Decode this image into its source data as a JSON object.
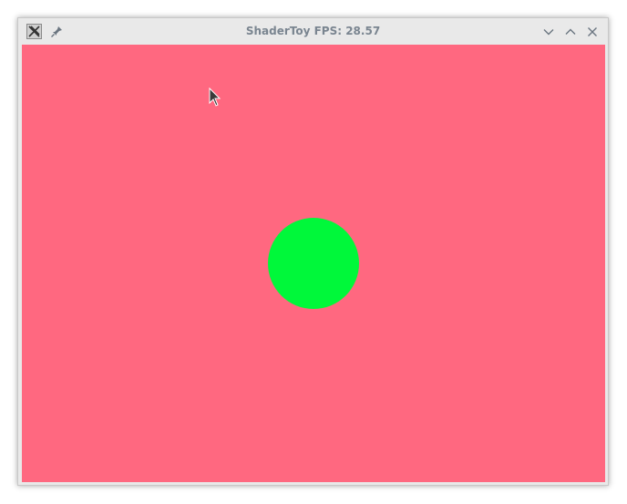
{
  "window": {
    "title": "ShaderToy FPS: 28.57",
    "app_icon": "x-app-icon",
    "pin_icon": "pin-icon",
    "controls": [
      "minimize-icon",
      "maximize-icon",
      "close-icon"
    ]
  },
  "canvas": {
    "background_color": "#ff6880",
    "circle_color": "#00f83a"
  }
}
